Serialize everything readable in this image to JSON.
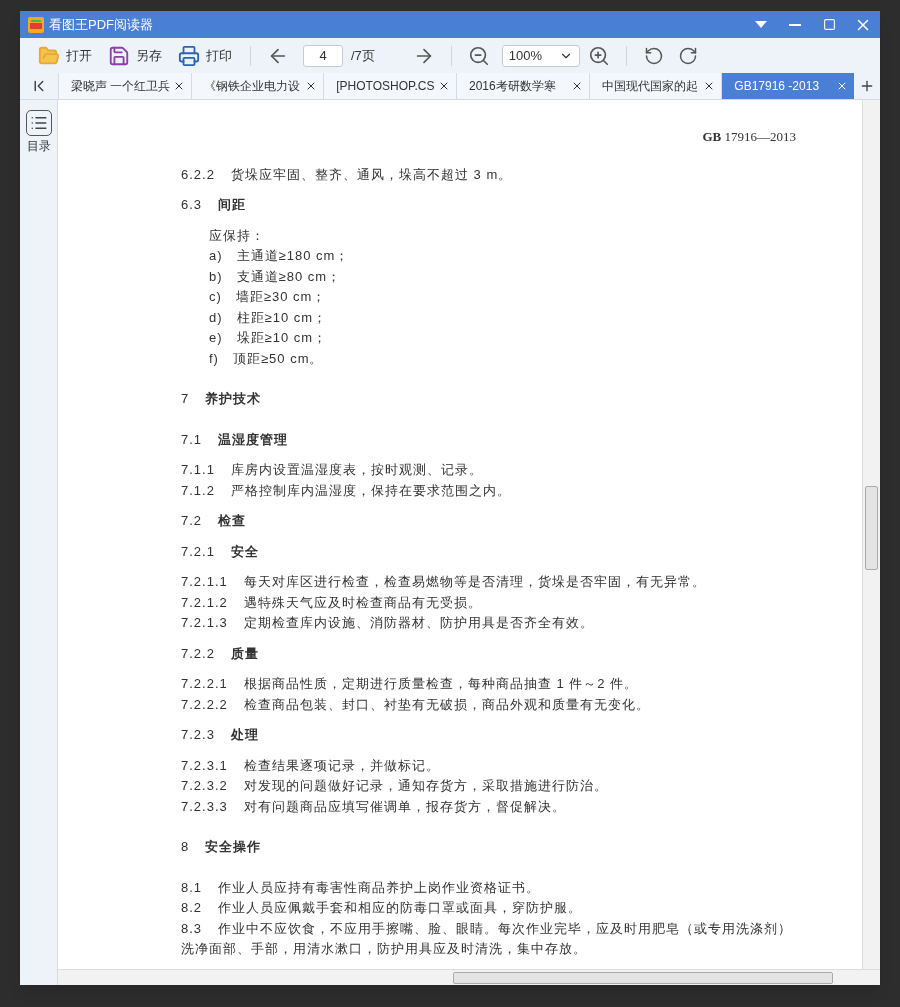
{
  "window": {
    "title": "看图王PDF阅读器"
  },
  "toolbar": {
    "open": "打开",
    "save_as": "另存",
    "print": "打印",
    "page": "4",
    "page_total": "/7页",
    "zoom": "100%"
  },
  "tabs": [
    {
      "label": "梁晓声 一个红卫兵",
      "selected": false
    },
    {
      "label": "《钢铁企业电力设",
      "selected": false
    },
    {
      "label": "[PHOTOSHOP.CS",
      "selected": false
    },
    {
      "label": "2016考研数学寒",
      "selected": false
    },
    {
      "label": "中国现代国家的起",
      "selected": false
    },
    {
      "label": "GB17916  -2013",
      "selected": true
    }
  ],
  "sidebar": {
    "label": "目录"
  },
  "document": {
    "header": "**GB** 17916—2013",
    "blocks": [
      {
        "kind": "clause",
        "number": "6.2.2",
        "text": "货垛应牢固、整齐、通风，垛高不超过 3 m。"
      },
      {
        "kind": "heading",
        "number": "6.3",
        "text": "间距"
      },
      {
        "kind": "intro",
        "text": "应保持："
      },
      {
        "kind": "item",
        "number": "a)",
        "text": "主通道≥180 cm；"
      },
      {
        "kind": "item",
        "number": "b)",
        "text": "支通道≥80 cm；"
      },
      {
        "kind": "item",
        "number": "c)",
        "text": "墙距≥30 cm；"
      },
      {
        "kind": "item",
        "number": "d)",
        "text": "柱距≥10 cm；"
      },
      {
        "kind": "item",
        "number": "e)",
        "text": "垛距≥10 cm；"
      },
      {
        "kind": "item",
        "number": "f)",
        "text": "顶距≥50 cm。"
      },
      {
        "kind": "chapter",
        "number": "7",
        "text": "养护技术"
      },
      {
        "kind": "heading",
        "number": "7.1",
        "text": "温湿度管理"
      },
      {
        "kind": "clause",
        "number": "7.1.1",
        "text": "库房内设置温湿度表，按时观测、记录。"
      },
      {
        "kind": "clause",
        "number": "7.1.2",
        "text": "严格控制库内温湿度，保持在要求范围之内。"
      },
      {
        "kind": "heading",
        "number": "7.2",
        "text": "检查"
      },
      {
        "kind": "heading",
        "number": "7.2.1",
        "text": "安全"
      },
      {
        "kind": "clause",
        "number": "7.2.1.1",
        "text": "每天对库区进行检查，检查易燃物等是否清理，货垛是否牢固，有无异常。"
      },
      {
        "kind": "clause",
        "number": "7.2.1.2",
        "text": "遇特殊天气应及时检查商品有无受损。"
      },
      {
        "kind": "clause",
        "number": "7.2.1.3",
        "text": "定期检查库内设施、消防器材、防护用具是否齐全有效。"
      },
      {
        "kind": "heading",
        "number": "7.2.2",
        "text": "质量"
      },
      {
        "kind": "clause",
        "number": "7.2.2.1",
        "text": "根据商品性质，定期进行质量检查，每种商品抽查 1 件～2 件。"
      },
      {
        "kind": "clause",
        "number": "7.2.2.2",
        "text": "检查商品包装、封口、衬垫有无破损，商品外观和质量有无变化。"
      },
      {
        "kind": "heading",
        "number": "7.2.3",
        "text": "处理"
      },
      {
        "kind": "clause",
        "number": "7.2.3.1",
        "text": "检查结果逐项记录，并做标记。"
      },
      {
        "kind": "clause",
        "number": "7.2.3.2",
        "text": "对发现的问题做好记录，通知存货方，采取措施进行防治。"
      },
      {
        "kind": "clause",
        "number": "7.2.3.3",
        "text": "对有问题商品应填写催调单，报存货方，督促解决。"
      },
      {
        "kind": "chapter",
        "number": "8",
        "text": "安全操作"
      },
      {
        "kind": "clause",
        "number": "8.1",
        "text": "作业人员应持有毒害性商品养护上岗作业资格证书。"
      },
      {
        "kind": "clause",
        "number": "8.2",
        "text": "作业人员应佩戴手套和相应的防毒口罩或面具，穿防护服。"
      },
      {
        "kind": "clause",
        "number": "8.3",
        "text": "作业中不应饮食，不应用手擦嘴、脸、眼睛。每次作业完毕，应及时用肥皂（或专用洗涤剂）洗净面部、手部，用清水漱口，防护用具应及时清洗，集中存放。"
      }
    ]
  }
}
